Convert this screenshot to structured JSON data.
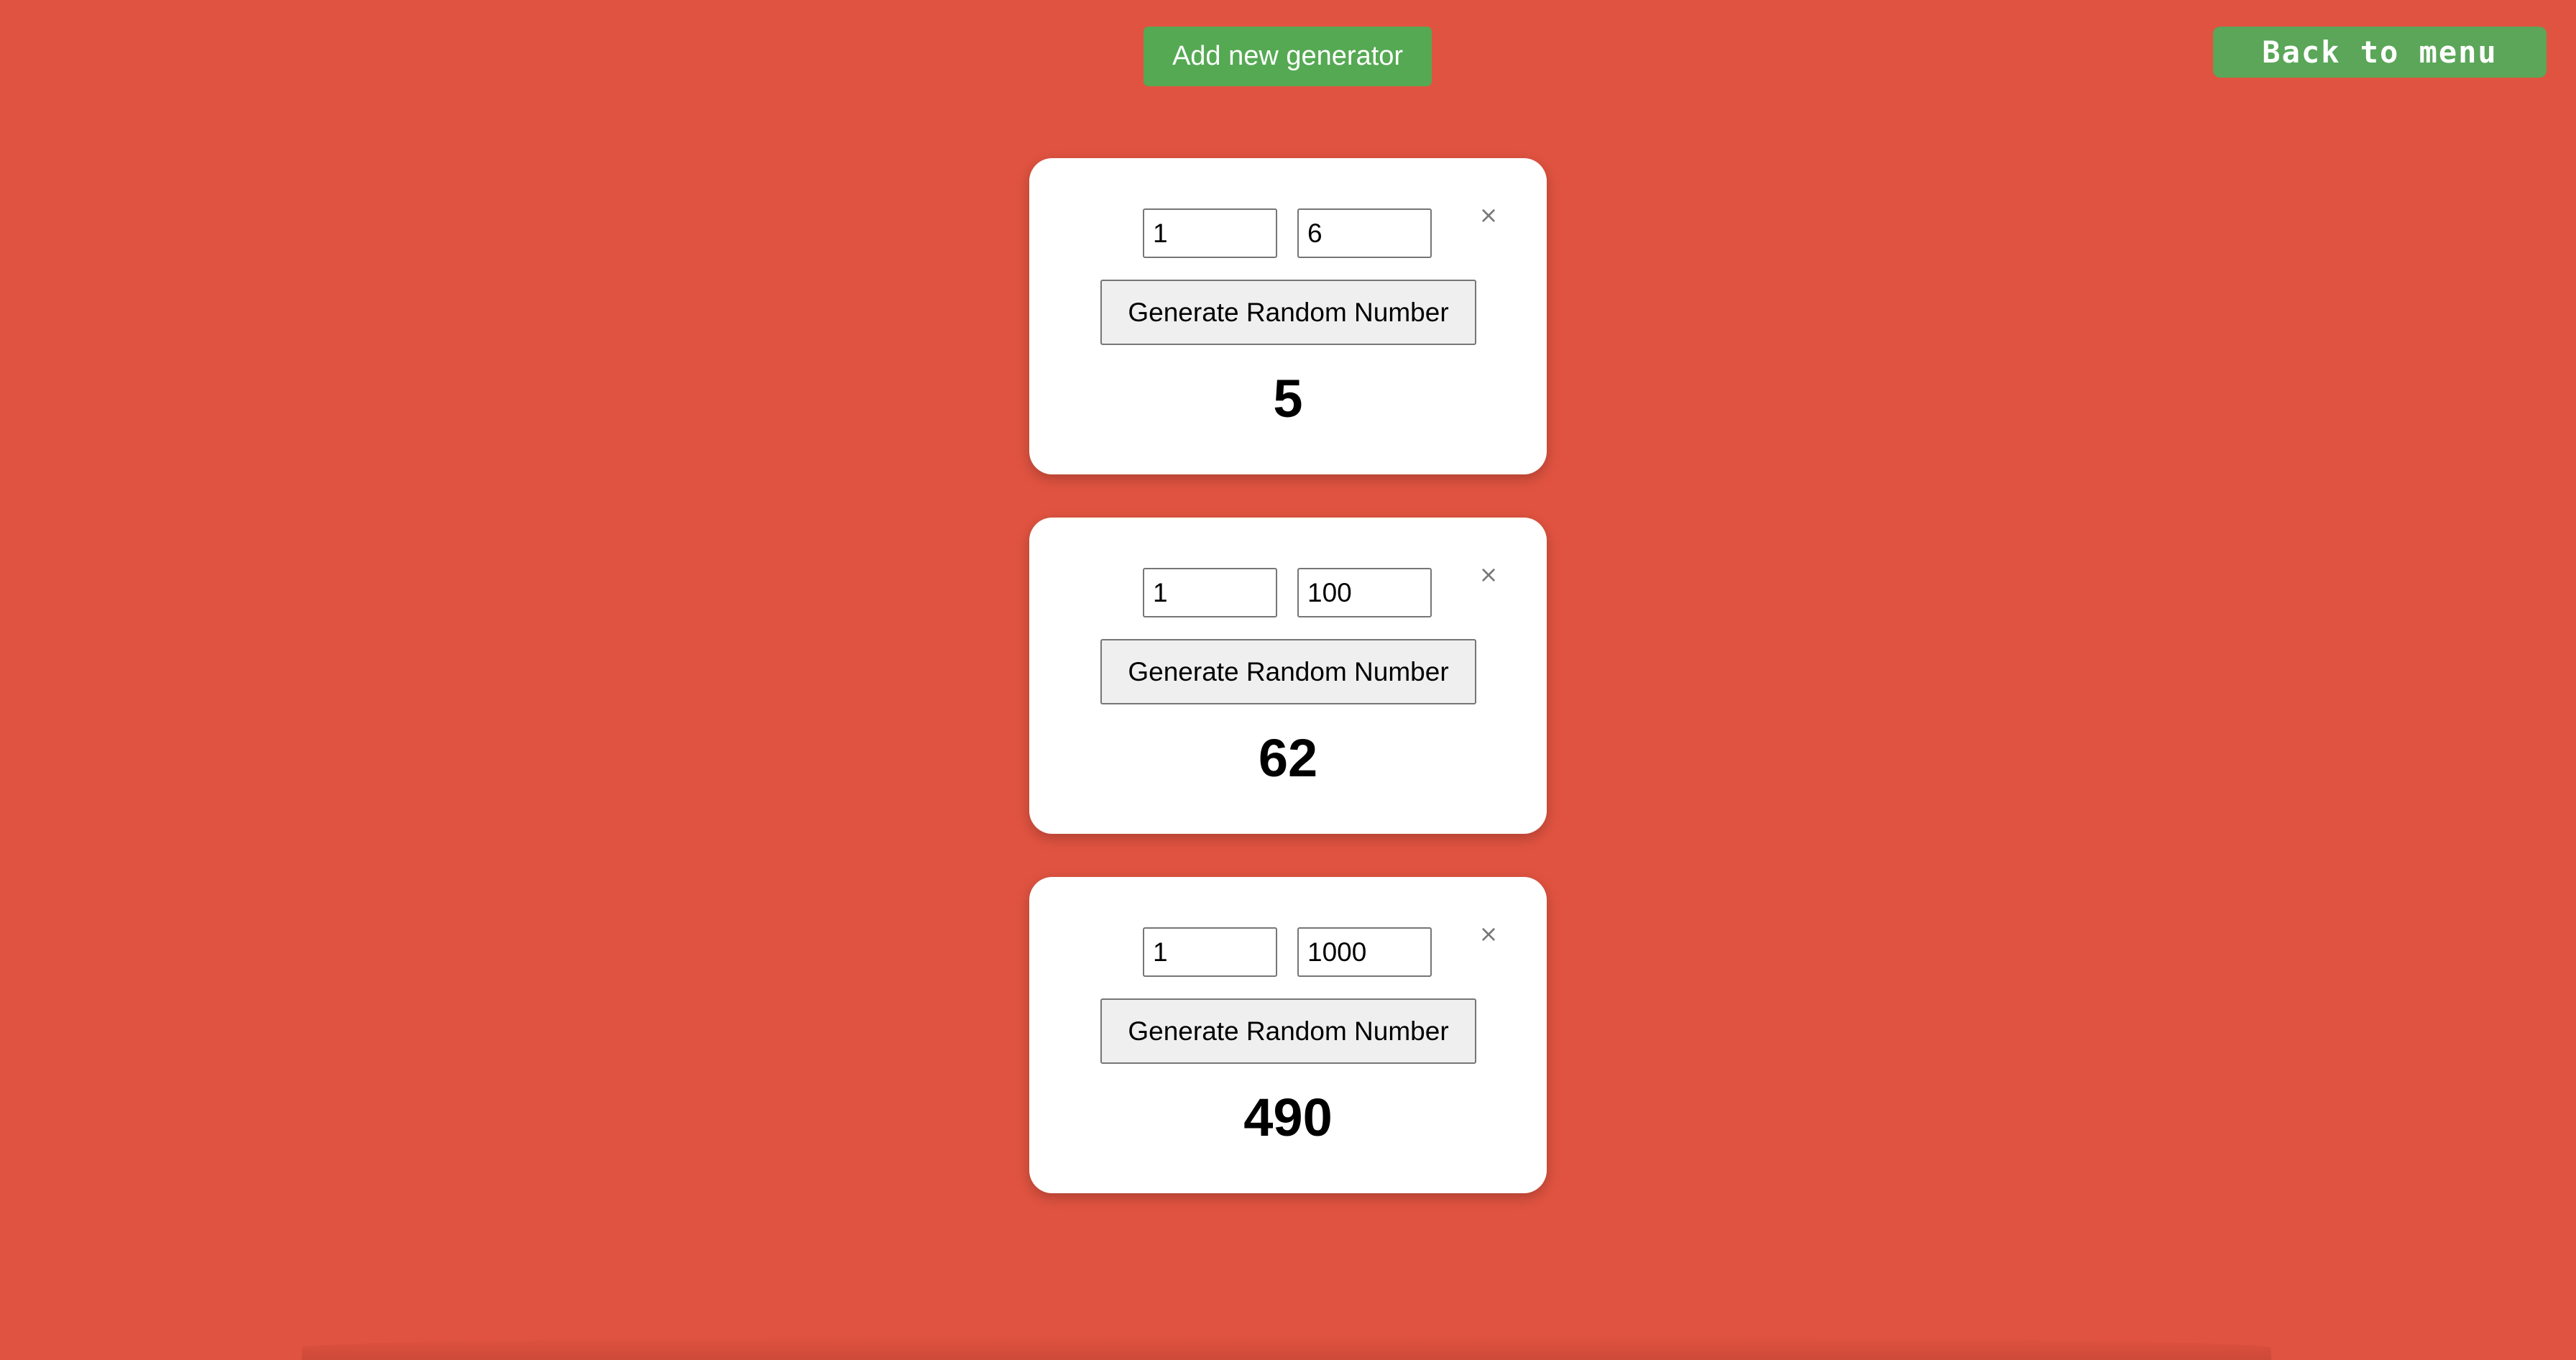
{
  "header": {
    "add_label": "Add new generator",
    "back_label": "Back to menu"
  },
  "generators": [
    {
      "min": "1",
      "max": "6",
      "button_label": "Generate Random Number",
      "result": "5",
      "close": "×"
    },
    {
      "min": "1",
      "max": "100",
      "button_label": "Generate Random Number",
      "result": "62",
      "close": "×"
    },
    {
      "min": "1",
      "max": "1000",
      "button_label": "Generate Random Number",
      "result": "490",
      "close": "×"
    }
  ],
  "colors": {
    "background": "#e05340",
    "accent_green": "#55a953",
    "card": "#ffffff"
  }
}
